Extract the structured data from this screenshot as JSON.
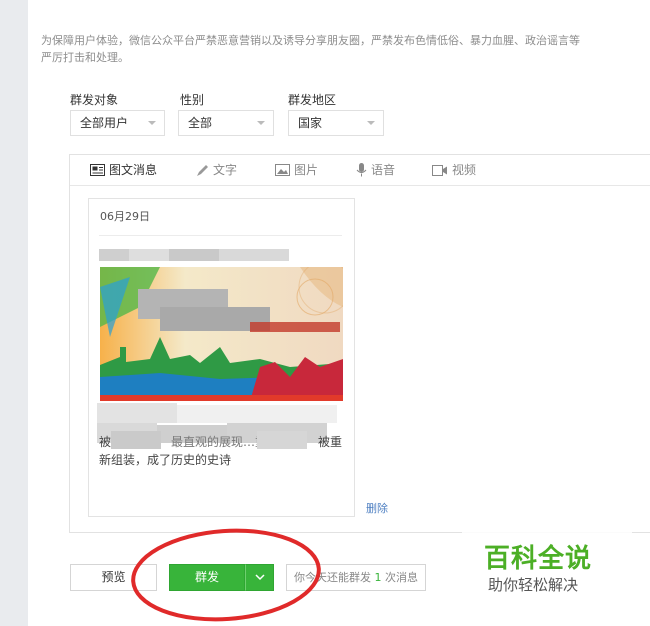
{
  "notice": {
    "line1": "为保障用户体验，微信公众平台严禁恶意营销以及诱导分享朋友圈，严禁发布色情低俗、暴力血腥、政治谣言等",
    "line2": "严厉打击和处理。"
  },
  "filters": [
    {
      "label": "群发对象",
      "value": "全部用户"
    },
    {
      "label": "性别",
      "value": "全部"
    },
    {
      "label": "群发地区",
      "value": "国家"
    }
  ],
  "tabs": [
    {
      "label": "图文消息",
      "icon": "news-icon",
      "active": true
    },
    {
      "label": "文字",
      "icon": "pen-icon",
      "active": false
    },
    {
      "label": "图片",
      "icon": "image-icon",
      "active": false
    },
    {
      "label": "语音",
      "icon": "microphone-icon",
      "active": false
    },
    {
      "label": "视频",
      "icon": "video-icon",
      "active": false
    }
  ],
  "article": {
    "date": "06月29日",
    "desc_line1": "被",
    "desc_line1b": "最直观的展现…重",
    "desc_line1c": "被重",
    "desc_line2": "新组装，成了历史的史诗"
  },
  "delete_label": "删除",
  "actions": {
    "preview_label": "预览",
    "send_label": "群发",
    "quota_prefix": "你今天还能群发",
    "quota_count": "1",
    "quota_suffix": "次消息"
  },
  "watermark": {
    "title": "百科全说",
    "subtitle": "助你轻松解决"
  },
  "colors": {
    "accent_green": "#38b43a",
    "link_blue": "#4f80c2",
    "annotation_red": "#e02a2a"
  }
}
